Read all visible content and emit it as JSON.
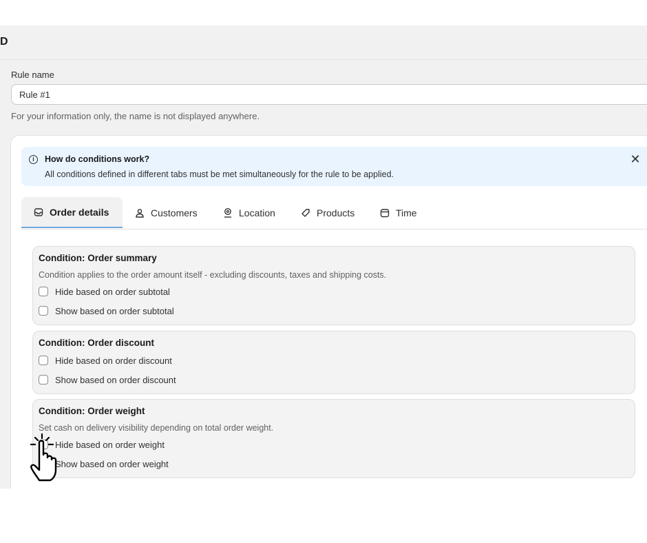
{
  "header": {
    "letter": "D"
  },
  "rule": {
    "label": "Rule name",
    "value": "Rule #1",
    "help": "For your information only, the name is not displayed anywhere."
  },
  "banner": {
    "icon": "info-icon",
    "title": "How do conditions work?",
    "text": "All conditions defined in different tabs must be met simultaneously for the rule to be applied.",
    "close_icon": "close-icon"
  },
  "tabs": [
    {
      "label": "Order details",
      "icon": "inbox-icon",
      "active": true
    },
    {
      "label": "Customers",
      "icon": "person-icon",
      "active": false
    },
    {
      "label": "Location",
      "icon": "location-pin-icon",
      "active": false
    },
    {
      "label": "Products",
      "icon": "tag-icon",
      "active": false
    },
    {
      "label": "Time",
      "icon": "calendar-icon",
      "active": false
    }
  ],
  "conditions": [
    {
      "title": "Condition: Order summary",
      "description": "Condition applies to the order amount itself - excluding discounts, taxes and shipping costs.",
      "options": [
        {
          "label": "Hide based on order subtotal",
          "checked": false
        },
        {
          "label": "Show based on order subtotal",
          "checked": false
        }
      ]
    },
    {
      "title": "Condition: Order discount",
      "options": [
        {
          "label": "Hide based on order discount",
          "checked": false
        },
        {
          "label": "Show based on order discount",
          "checked": false
        }
      ]
    },
    {
      "title": "Condition: Order weight",
      "description": "Set cash on delivery visibility depending on total order weight.",
      "options": [
        {
          "label": "Hide based on order weight",
          "checked": false
        },
        {
          "label": "Show based on order weight",
          "checked": false
        }
      ]
    }
  ],
  "colors": {
    "panel_bg": "#f1f1f1",
    "banner_bg": "#eaf4ff",
    "active_tab_underline": "#6fa8dc",
    "text": "#303030",
    "muted_text": "#616161"
  }
}
